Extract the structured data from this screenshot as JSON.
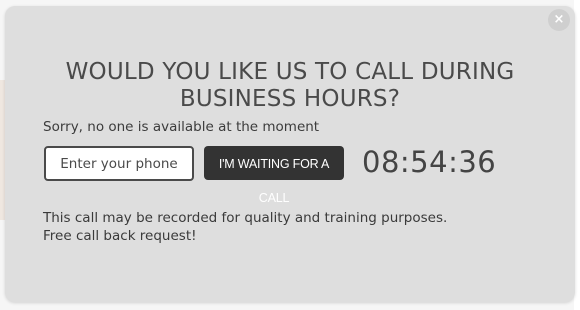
{
  "modal": {
    "close_symbol": "×",
    "title_line1": "WOULD YOU LIKE US TO CALL DURING",
    "title_line2": "BUSINESS HOURS?",
    "subtitle": "Sorry, no one is available at the moment",
    "phone_placeholder": "Enter your phone",
    "call_button_label": "I'M WAITING FOR A CALL",
    "timer": "08:54:36",
    "note_line1": "This call may be recorded for quality and training purposes.",
    "note_line2": "Free call back request!"
  },
  "colors": {
    "modal_bg": "#dedede",
    "button_bg": "#333333",
    "text": "#4a4a4a"
  },
  "icons": {
    "close": "close-icon"
  }
}
